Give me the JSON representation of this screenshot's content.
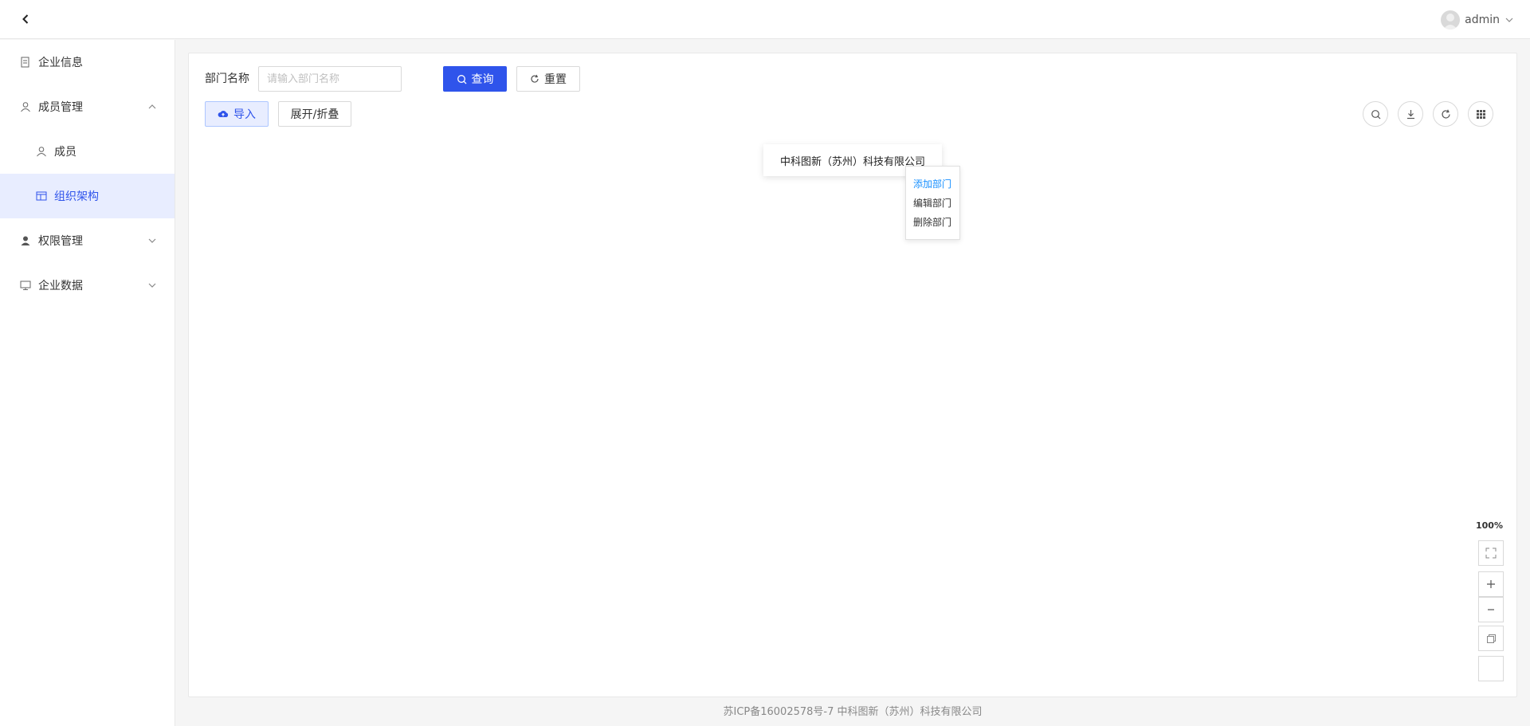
{
  "header": {
    "username": "admin"
  },
  "sidebar": {
    "items": [
      {
        "label": "企业信息"
      },
      {
        "label": "成员管理"
      },
      {
        "label": "成员"
      },
      {
        "label": "组织架构"
      },
      {
        "label": "权限管理"
      },
      {
        "label": "企业数据"
      }
    ]
  },
  "search": {
    "label": "部门名称",
    "placeholder": "请输入部门名称",
    "query_label": "查询",
    "reset_label": "重置"
  },
  "toolbar": {
    "import_label": "导入",
    "expand_label": "展开/折叠"
  },
  "org_chart": {
    "root_node": "中科图新（苏州）科技有限公司",
    "context_menu": [
      "添加部门",
      "编辑部门",
      "删除部门"
    ],
    "zoom": "100%"
  },
  "footer": {
    "text": "苏ICP备16002578号-7 中科图新（苏州）科技有限公司"
  },
  "colors": {
    "primary": "#2f54eb",
    "active_bg": "#e8edff",
    "link": "#1890ff"
  }
}
